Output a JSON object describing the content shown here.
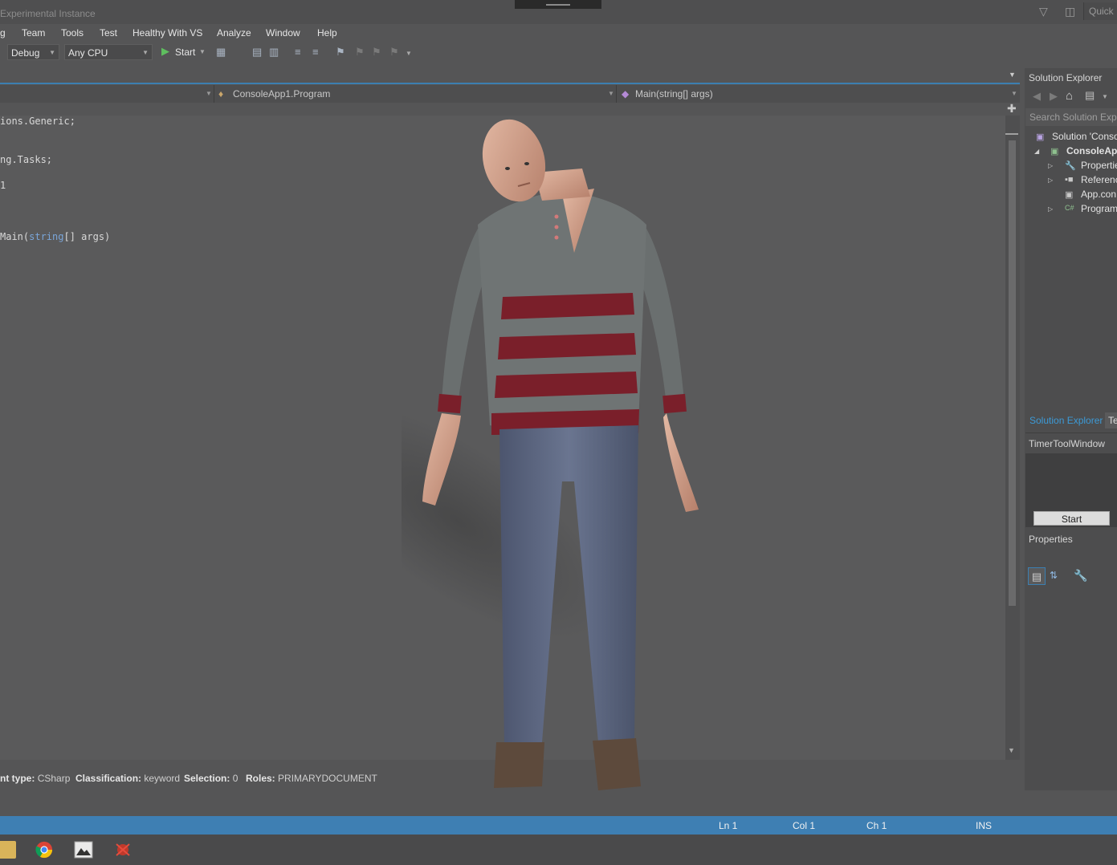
{
  "window": {
    "title": "Experimental Instance",
    "quick_launch": "Quick"
  },
  "menu": [
    "g",
    "Team",
    "Tools",
    "Test",
    "Healthy With VS",
    "Analyze",
    "Window",
    "Help"
  ],
  "toolbar": {
    "config": "Debug",
    "platform": "Any CPU",
    "start_label": "Start"
  },
  "navbar": {
    "class_combo": "ConsoleApp1.Program",
    "member_combo": "Main(string[] args)"
  },
  "code": {
    "line1": "ions.Generic;",
    "line2": "ng.Tasks;",
    "line3": "1",
    "line4_pre": "Main(",
    "line4_kw": "string",
    "line4_post": "[] args)"
  },
  "info": {
    "content_type_label": "nt type:",
    "content_type": "CSharp",
    "classification_label": "Classification:",
    "classification": "keyword",
    "selection_label": "Selection:",
    "selection": "0",
    "roles_label": "Roles:",
    "roles": "PRIMARYDOCUMENT"
  },
  "solution_explorer": {
    "title": "Solution Explorer",
    "search_placeholder": "Search Solution Explo",
    "items": [
      "Solution 'Conso",
      "ConsoleApp",
      "Propertie",
      "Referenc",
      "App.con",
      "Program"
    ],
    "tab_active": "Solution Explorer",
    "tab_other": "Te"
  },
  "timer_window": {
    "title": "TimerToolWindow",
    "start_button": "Start"
  },
  "properties": {
    "title": "Properties"
  },
  "statusbar": {
    "ln": "Ln 1",
    "col": "Col 1",
    "ch": "Ch 1",
    "mode": "INS"
  },
  "colors": {
    "accent": "#3e7fb3",
    "sweater_gray": "#6f7474",
    "stripe_red": "#7a1f2a",
    "jeans": "#56607a"
  }
}
